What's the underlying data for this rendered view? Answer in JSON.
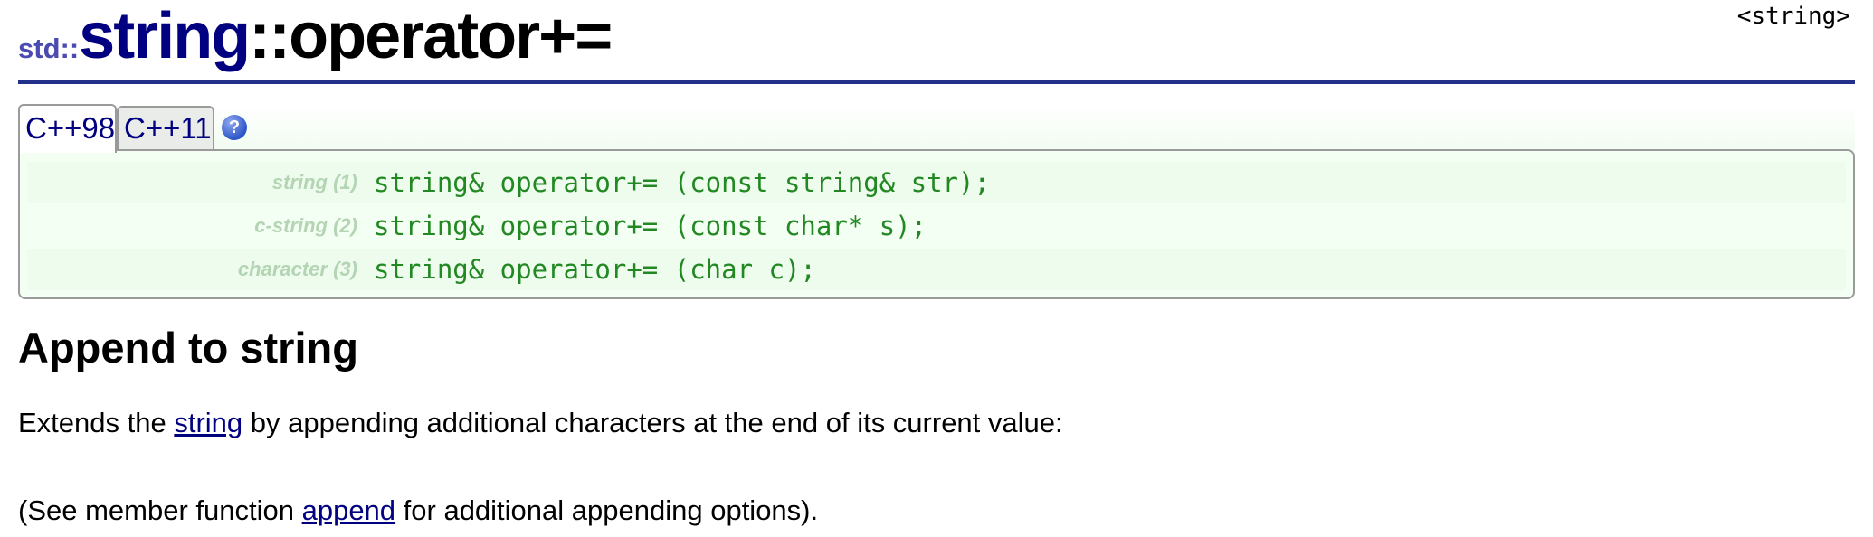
{
  "header": {
    "header_file": "<string>",
    "namespace": "std::",
    "class_name": "string",
    "member_name": "::operator+="
  },
  "tabs": [
    {
      "label": "C++98",
      "active": true
    },
    {
      "label": "C++11",
      "active": false
    }
  ],
  "help_icon": {
    "glyph": "?",
    "icon": "help-icon"
  },
  "prototypes": [
    {
      "label": "string",
      "index": "(1)",
      "code": "string& operator+= (const string& str);"
    },
    {
      "label": "c-string",
      "index": "(2)",
      "code": "string& operator+= (const char* s);"
    },
    {
      "label": "character",
      "index": "(3)",
      "code": "string& operator+= (char c);"
    }
  ],
  "section": {
    "heading": "Append to string"
  },
  "paragraph1": {
    "before": "Extends the ",
    "link": "string",
    "after": " by appending additional characters at the end of its current value:"
  },
  "paragraph2": {
    "before": "(See member function ",
    "link": "append",
    "after": " for additional appending options)."
  },
  "colors": {
    "title_class": "#000080",
    "namespace": "#4a4ab0",
    "rule": "#23308a",
    "code": "#228822",
    "proto_label": "#b4d4b4",
    "link": "#000080",
    "box_bg": "#f4fff4"
  }
}
